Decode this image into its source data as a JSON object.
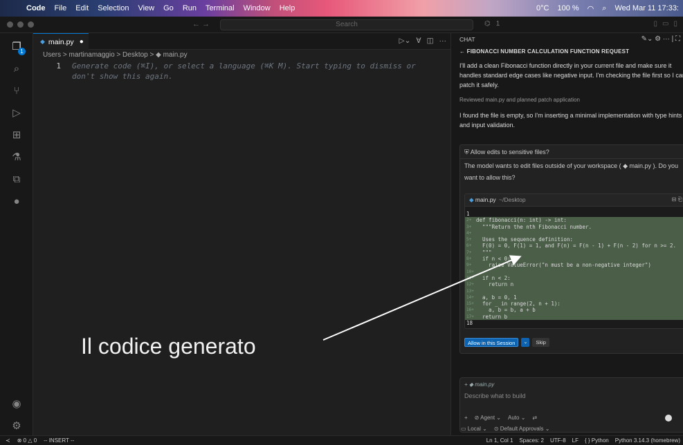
{
  "menubar": {
    "app": "Code",
    "items": [
      "File",
      "Edit",
      "Selection",
      "View",
      "Go",
      "Run",
      "Terminal",
      "Window",
      "Help"
    ],
    "weather": "0°C",
    "battery": "100 %",
    "datetime": "Wed Mar 11 17:33:"
  },
  "titlebar": {
    "search_placeholder": "Search",
    "badge_count": "1"
  },
  "activity": {
    "explorer_badge": "1"
  },
  "editor": {
    "tab_label": "main.py",
    "tab_dirty": "●",
    "breadcrumb": "Users > martinamaggio > Desktop > ◆ main.py",
    "line_number": "1",
    "ghost_line1": "Generate code (⌘I), or select a language (⌘K M). Start typing to dismiss or",
    "ghost_line2": "don't show this again."
  },
  "chat": {
    "header": "CHAT",
    "title": "FIBONACCI NUMBER CALCULATION FUNCTION REQUEST",
    "msg1_line1": "I'll add a clean Fibonacci function directly in your current file and make sure it",
    "msg1_line2": "handles standard edge cases like negative input. I'm checking the file first so I can",
    "msg1_line3": "patch it safely.",
    "reviewed": "Reviewed main.py and planned patch application",
    "msg2_line1": "I found the file is empty, so I'm inserting a minimal implementation with type hints",
    "msg2_line2": "and input validation.",
    "perm_title": "Allow edits to sensitive files?",
    "perm_line1": "The model wants to edit files outside of your workspace ( ◆ main.py ). Do you",
    "perm_line2": "want to allow this?",
    "diff_file": "main.py",
    "diff_path": "~/Desktop",
    "diff_lines": [
      {
        "n": "1",
        "code": "",
        "add": false
      },
      {
        "n": "2+",
        "code": "def fibonacci(n: int) -> int:",
        "add": true
      },
      {
        "n": "3+",
        "code": "  \"\"\"Return the nth Fibonacci number.",
        "add": true
      },
      {
        "n": "4+",
        "code": "",
        "add": true
      },
      {
        "n": "5+",
        "code": "  Uses the sequence definition:",
        "add": true
      },
      {
        "n": "6+",
        "code": "  F(0) = 0, F(1) = 1, and F(n) = F(n - 1) + F(n - 2) for n >= 2.",
        "add": true
      },
      {
        "n": "7+",
        "code": "  \"\"\"",
        "add": true
      },
      {
        "n": "8+",
        "code": "  if n < 0:",
        "add": true
      },
      {
        "n": "9+",
        "code": "    raise ValueError(\"n must be a non-negative integer\")",
        "add": true
      },
      {
        "n": "10+",
        "code": "",
        "add": true
      },
      {
        "n": "11+",
        "code": "  if n < 2:",
        "add": true
      },
      {
        "n": "12+",
        "code": "    return n",
        "add": true
      },
      {
        "n": "13+",
        "code": "",
        "add": true
      },
      {
        "n": "14+",
        "code": "  a, b = 0, 1",
        "add": true
      },
      {
        "n": "15+",
        "code": "  for _ in range(2, n + 1):",
        "add": true
      },
      {
        "n": "16+",
        "code": "    a, b = b, a + b",
        "add": true
      },
      {
        "n": "17+",
        "code": "  return b",
        "add": true
      },
      {
        "n": "18",
        "code": "",
        "add": false
      }
    ],
    "allow_label": "Allow in this Session",
    "skip_label": "Skip",
    "attach_label": "+ ◆ main.py",
    "input_placeholder": "Describe what to build",
    "agent_label": "Agent",
    "auto_label": "Auto",
    "local_label": "Local",
    "approvals_label": "Default Approvals"
  },
  "statusbar": {
    "problems": "0 △ 0",
    "mode": "-- INSERT --",
    "position": "Ln 1, Col 1",
    "spaces": "Spaces: 2",
    "encoding": "UTF-8",
    "eol": "LF",
    "language": "{ } Python",
    "interpreter": "Python 3.14.3 (homebrew)"
  },
  "annotation": {
    "text": "Il codice generato"
  }
}
